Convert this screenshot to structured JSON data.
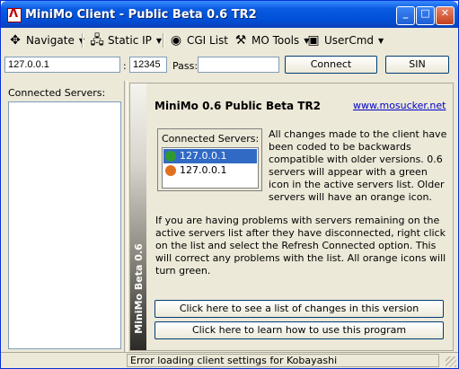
{
  "window": {
    "title": "MiniMo Client - Public Beta 0.6 TR2"
  },
  "toolbar": {
    "navigate": "Navigate",
    "static_ip": "Static IP",
    "cgi_list": "CGI List",
    "mo_tools": "MO Tools",
    "user_cmd": "UserCmd"
  },
  "connect_bar": {
    "host": "127.0.0.1",
    "colon": ":",
    "port": "12345",
    "pass_label": "Pass:",
    "pass_value": "",
    "connect_label": "Connect",
    "sin_label": "SIN"
  },
  "left_panel": {
    "title": "Connected Servers:"
  },
  "content": {
    "side_label": "MiniMo Beta 0.6",
    "title": "MiniMo 0.6 Public Beta TR2",
    "link": "www.mosucker.net",
    "mini_list": {
      "title": "Connected Servers:",
      "items": [
        {
          "label": "127.0.0.1",
          "color": "#2e9a2e"
        },
        {
          "label": "127.0.0.1",
          "color": "#e07020"
        }
      ]
    },
    "para1": "All changes made to the client have been coded to be backwards compatible with older versions. 0.6 servers will appear with a green icon in the active servers list. Older servers will have an orange icon.",
    "para2": "If you are having problems with servers remaining on the active servers list after they have disconnected, right click on the list and select the Refresh Connected option. This will correct any problems with the list. All orange icons will turn green.",
    "btn_changes": "Click here to see a list of changes in this version",
    "btn_howto": "Click here to learn how to use this program"
  },
  "status": {
    "text": "Error loading client settings for Kobayashi"
  }
}
